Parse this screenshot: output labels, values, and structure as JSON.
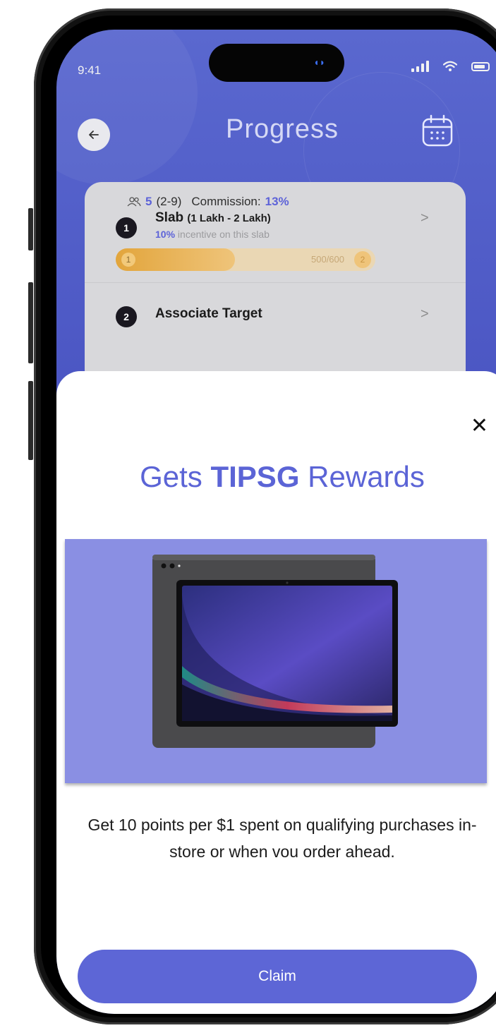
{
  "status_bar": {
    "time": "9:41"
  },
  "header": {
    "title": "Progress"
  },
  "slab": {
    "number": "1",
    "title": "Slab",
    "range": "(1 Lakh - 2 Lakh)",
    "incentive_pct": "10%",
    "incentive_text": "incentive on this slab",
    "progress": {
      "current": 500,
      "target": 600,
      "label": "500/600",
      "start_level": "1",
      "end_level": "2"
    }
  },
  "associate": {
    "number": "2",
    "title": "Associate Target",
    "count": "5",
    "range": "(2-9)",
    "commission_label": "Commission:",
    "commission_pct": "13%"
  },
  "rewards": {
    "title_pre": "Gets",
    "title_brand": "TIPSG",
    "title_post": "Rewards",
    "description": "Get 10 points per $1 spent on qualifying purchases in-store or when vou order ahead.",
    "claim_label": "Claim"
  },
  "colors": {
    "accent": "#5d66d6",
    "promo_bg": "#8a8fe3",
    "header_bg": "#4c57c4",
    "progress": "#e2a53c"
  }
}
